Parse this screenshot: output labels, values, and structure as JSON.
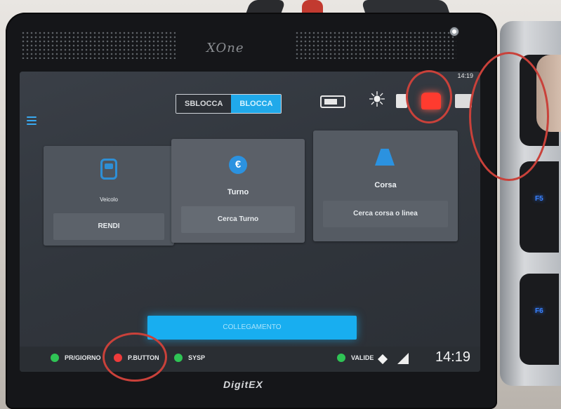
{
  "device": {
    "brand_top": "XOne",
    "brand_bottom": "DigitEX",
    "brand_sub": ""
  },
  "status_top": "14:19",
  "toggle": {
    "off_label": "SBLOCCA",
    "on_label": "BLOCCA"
  },
  "top_icons": [
    "battery-icon",
    "sun-icon",
    "doc-icon",
    "alarm-icon",
    "mail-icon"
  ],
  "cards": [
    {
      "title": "Veicolo",
      "button": "RENDI",
      "icon": "bus-icon"
    },
    {
      "title": "Turno",
      "button": "Cerca Turno",
      "icon": "euro-icon"
    },
    {
      "title": "Corsa",
      "button": "Cerca corsa o linea",
      "icon": "road-icon"
    }
  ],
  "connect_button": "COLLEGAMENTO",
  "bottom_status": [
    {
      "label": "PR/GIORNO",
      "color": "#2fc455"
    },
    {
      "label": "P.BUTTON",
      "color": "#ee3b3b"
    },
    {
      "label": "SYSP",
      "color": "#2fc455"
    },
    {
      "label": "VALIDE",
      "color": "#2fc455"
    }
  ],
  "clock": "14:19",
  "side_keys": [
    "",
    "F5",
    "F6"
  ],
  "colors": {
    "accent": "#20a9ea",
    "alarm": "#ff3b2f",
    "annotation": "#c9413a"
  }
}
